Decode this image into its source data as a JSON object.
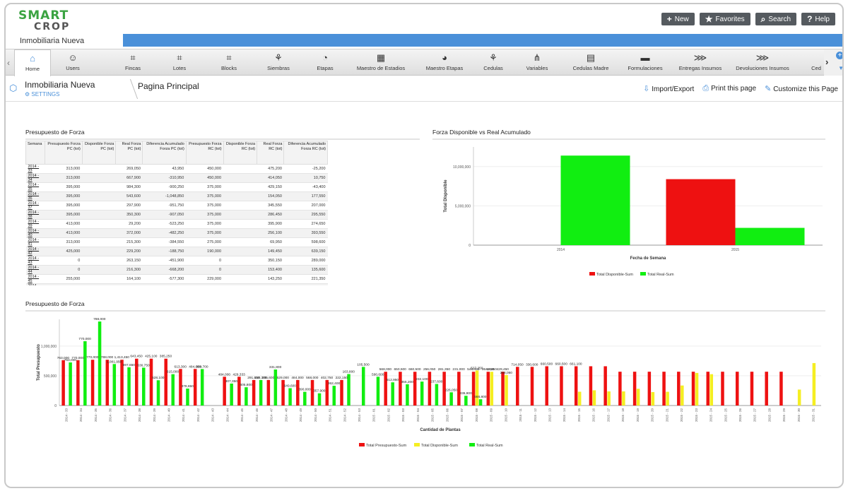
{
  "header": {
    "logo_line1": "SMART",
    "logo_line2": "CROP",
    "company": "Inmobiliaria Nueva",
    "buttons": [
      {
        "icon": "plus-icon",
        "glyph": "+",
        "label": "New"
      },
      {
        "icon": "star-icon",
        "glyph": "★",
        "label": "Favorites"
      },
      {
        "icon": "search-icon",
        "glyph": "⌕",
        "label": "Search"
      },
      {
        "icon": "help-icon",
        "glyph": "?",
        "label": "Help"
      }
    ]
  },
  "nav": {
    "items": [
      {
        "label": "Home",
        "icon": "home-icon",
        "glyph": "⌂"
      },
      {
        "label": "Users",
        "icon": "user-icon",
        "glyph": "☺"
      },
      {
        "label": "Fincas",
        "icon": "grid-icon",
        "glyph": "⌗"
      },
      {
        "label": "Lotes",
        "icon": "grid-icon",
        "glyph": "⌗"
      },
      {
        "label": "Blocks",
        "icon": "grid-icon",
        "glyph": "⌗"
      },
      {
        "label": "Siembras",
        "icon": "plant-icon",
        "glyph": "⚘"
      },
      {
        "label": "Etapas",
        "icon": "gauge-icon",
        "glyph": "◔"
      },
      {
        "label": "Maestro de Estadios",
        "icon": "table-icon",
        "glyph": "▦"
      },
      {
        "label": "Maestro Etapas",
        "icon": "gauge-icon",
        "glyph": "◕"
      },
      {
        "label": "Cedulas",
        "icon": "plant-icon",
        "glyph": "⚘"
      },
      {
        "label": "Variables",
        "icon": "tree-icon",
        "glyph": "⋔"
      },
      {
        "label": "Cedulas Madre",
        "icon": "document-icon",
        "glyph": "▤"
      },
      {
        "label": "Formulaciones",
        "icon": "laptop-icon",
        "glyph": "▬"
      },
      {
        "label": "Entregas Insumos",
        "icon": "arrows-icon",
        "glyph": "⋙"
      },
      {
        "label": "Devoluciones Insumos",
        "icon": "arrows-icon",
        "glyph": "⋙"
      },
      {
        "label": "Ced",
        "icon": "more-icon",
        "glyph": ""
      }
    ]
  },
  "subheader": {
    "app_name": "Inmobiliaria Nueva",
    "settings": "SETTINGS",
    "page_title": "Pagina Principal",
    "actions": [
      {
        "icon": "download-icon",
        "glyph": "⇩",
        "label": "Import/Export"
      },
      {
        "icon": "print-icon",
        "glyph": "⎙",
        "label": "Print this page"
      },
      {
        "icon": "wrench-icon",
        "glyph": "✎",
        "label": "Customize this Page"
      }
    ]
  },
  "table": {
    "title": "Presupuesto de Forza",
    "columns": [
      "Semana",
      "Presupuesto Forza PC (tot)",
      "Disponible Forza PC (tot)",
      "Real Forza PC (tot)",
      "Diferencia Acumulado Forza PC (tot)",
      "Presupuesto Forza RC (tot)",
      "Disponible Forza RC (tot)",
      "Real Forza RC (tot)",
      "Diferencia Acumulado Forza RC (tot)"
    ],
    "rows": [
      [
        "2014 - 33",
        "313,000",
        "",
        "269,050",
        "43,950",
        "450,000",
        "",
        "475,200",
        "-25,200"
      ],
      [
        "2014 - 34",
        "313,000",
        "",
        "667,900",
        "-310,950",
        "450,000",
        "",
        "414,050",
        "10,750"
      ],
      [
        "2014 - 35",
        "395,000",
        "",
        "984,300",
        "-900,250",
        "375,000",
        "",
        "429,150",
        "-43,400"
      ],
      [
        "2014 - 36",
        "395,000",
        "",
        "543,600",
        "-1,048,850",
        "375,000",
        "",
        "154,050",
        "177,550"
      ],
      [
        "2014 - 37",
        "395,000",
        "",
        "297,900",
        "-951,750",
        "375,000",
        "",
        "345,550",
        "207,000"
      ],
      [
        "2014 - 38",
        "395,000",
        "",
        "350,300",
        "-907,050",
        "375,000",
        "",
        "286,450",
        "295,550"
      ],
      [
        "2014 - 39",
        "413,000",
        "",
        "29,200",
        "-523,250",
        "375,000",
        "",
        "395,900",
        "274,650"
      ],
      [
        "2014 - 40",
        "413,000",
        "",
        "372,000",
        "-482,250",
        "375,000",
        "",
        "256,100",
        "393,550"
      ],
      [
        "2014 - 41",
        "313,000",
        "",
        "215,300",
        "-384,550",
        "275,000",
        "",
        "69,950",
        "598,600"
      ],
      [
        "2014 - 42",
        "425,000",
        "",
        "229,200",
        "-188,750",
        "190,000",
        "",
        "149,450",
        "639,150"
      ],
      [
        "2014 - 43",
        "0",
        "",
        "263,150",
        "-451,900",
        "0",
        "",
        "350,150",
        "289,000"
      ],
      [
        "2014 - 44",
        "0",
        "",
        "216,300",
        "-668,200",
        "0",
        "",
        "153,400",
        "135,600"
      ],
      [
        "2014 - 45",
        "255,000",
        "",
        "164,100",
        "-577,300",
        "229,000",
        "",
        "143,250",
        "221,350"
      ],
      [
        "2014 - 46",
        "255,000",
        "",
        "284,650",
        "-606,950",
        "229,000",
        "",
        "146,200",
        "304,150"
      ]
    ]
  },
  "chart_data": [
    {
      "type": "bar",
      "title": "Forza Disponible vs Real Acumulado",
      "xlabel": "Fecha de Semana",
      "ylabel": "Total Disponible",
      "categories": [
        "2014",
        "2015"
      ],
      "series": [
        {
          "name": "Total Disponible-Sum",
          "color": "#ee1111",
          "values": [
            0,
            8400000
          ]
        },
        {
          "name": "Total Real-Sum",
          "color": "#11ee11",
          "values": [
            11400000,
            2200000
          ]
        }
      ],
      "yticks": [
        "0",
        "5,000,000",
        "10,000,000"
      ],
      "ylim": [
        0,
        12500000
      ],
      "legend": "bottom"
    },
    {
      "type": "bar",
      "title": "Presupuesto de Forza",
      "xlabel": "Cantidad de Plantas",
      "ylabel": "Total Presupuesto",
      "yticks": [
        "0",
        "500,000",
        "1,000,000"
      ],
      "ylim": [
        0,
        1450000
      ],
      "legend": "bottom",
      "categories": [
        "2014 - 33",
        "2014 - 34",
        "2014 - 35",
        "2014 - 36",
        "2014 - 37",
        "2014 - 38",
        "2014 - 39",
        "2014 - 40",
        "2014 - 41",
        "2014 - 42",
        "2014 - 43",
        "2014 - 44",
        "2014 - 45",
        "2014 - 46",
        "2014 - 47",
        "2014 - 48",
        "2014 - 49",
        "2014 - 50",
        "2014 - 51",
        "2014 - 52",
        "2014 - 53",
        "2015 - 01",
        "2015 - 02",
        "2015 - 03",
        "2015 - 04",
        "2015 - 05",
        "2015 - 06",
        "2015 - 07",
        "2015 - 08",
        "2015 - 09",
        "2015 - 10",
        "2015 - 11",
        "2015 - 12",
        "2015 - 13",
        "2015 - 14",
        "2015 - 15",
        "2015 - 16",
        "2015 - 17",
        "2015 - 18",
        "2015 - 19",
        "2015 - 20",
        "2015 - 21",
        "2015 - 22",
        "2015 - 23",
        "2015 - 24",
        "2015 - 25",
        "2015 - 26",
        "2015 - 27",
        "2015 - 28",
        "2015 - 29",
        "2015 - 30",
        "2015 - 31"
      ],
      "series": [
        {
          "name": "Total Presupuesto-Sum",
          "color": "#ee1111",
          "values": [
            763000,
            763000,
            770000,
            770000,
            770000,
            788000,
            788000,
            788000,
            615000,
            615000,
            0,
            484000,
            484000,
            429333,
            429333,
            429333,
            429333,
            429333,
            429333,
            429333,
            0,
            0,
            568000,
            568000,
            568000,
            568000,
            568000,
            568000,
            568000,
            568000,
            568000,
            650500,
            650500,
            660500,
            660500,
            660500,
            660500,
            660500,
            568800,
            568800,
            568800,
            568800,
            568800,
            568800,
            568800,
            568800,
            568800,
            568800,
            568800,
            568800,
            0,
            0
          ]
        },
        {
          "name": "Total Disponible-Sum",
          "color": "#f5ee22",
          "values": [
            0,
            0,
            0,
            0,
            0,
            0,
            0,
            0,
            0,
            0,
            0,
            0,
            0,
            0,
            0,
            0,
            0,
            0,
            0,
            0,
            0,
            0,
            0,
            0,
            0,
            0,
            0,
            0,
            590000,
            568000,
            512950,
            0,
            0,
            0,
            0,
            232100,
            256050,
            237600,
            237600,
            281350,
            226050,
            231000,
            336800,
            548000,
            527250,
            0,
            0,
            0,
            0,
            0,
            268050,
            714050
          ]
        },
        {
          "name": "Total Real-Sum",
          "color": "#11ee11",
          "values": [
            725000,
            1081950,
            1413450,
            697650,
            643450,
            636750,
            425100,
            527100,
            285250,
            613300,
            0,
            369700,
            307350,
            429333,
            605800,
            291650,
            230300,
            205600,
            331800,
            529000,
            649600,
            484000,
            390000,
            357900,
            402750,
            362400,
            222150,
            163800,
            105500,
            0,
            0,
            0,
            0,
            0,
            0,
            0,
            0,
            0,
            0,
            0,
            0,
            0,
            0,
            0,
            0,
            0,
            0,
            0,
            0,
            0,
            0,
            0
          ]
        }
      ],
      "data_labels": [
        "763,000",
        "763,000",
        "770,000",
        "770,000",
        "770,000",
        "788,000",
        "788,000",
        "1,081,950",
        "1,413,450",
        "697,650",
        "643,450",
        "636,750",
        "425,100",
        "528,100",
        "385,250",
        "615,000",
        "613,300",
        "378,650",
        "484,000",
        "369,700",
        "484,000",
        "307,350",
        "429,333",
        "605,800",
        "291,650",
        "230,300",
        "205,600",
        "331,800",
        "529,000",
        "649,600",
        "484,000",
        "390,000",
        "568,000",
        "357,900",
        "402,750",
        "362,400",
        "222,150",
        "163,800",
        "105,500",
        "590,600",
        "568,000",
        "512,950",
        "650,500",
        "355,200",
        "660,500",
        "232,100",
        "256,050",
        "237,600",
        "281,350",
        "226,050",
        "231,000",
        "336,800",
        "548,000",
        "527,250",
        "568,800",
        "364,350",
        "98,350",
        "429,450",
        "268,050",
        "714,050",
        "330,600",
        "660,500",
        "660,500",
        "661,100"
      ]
    }
  ]
}
